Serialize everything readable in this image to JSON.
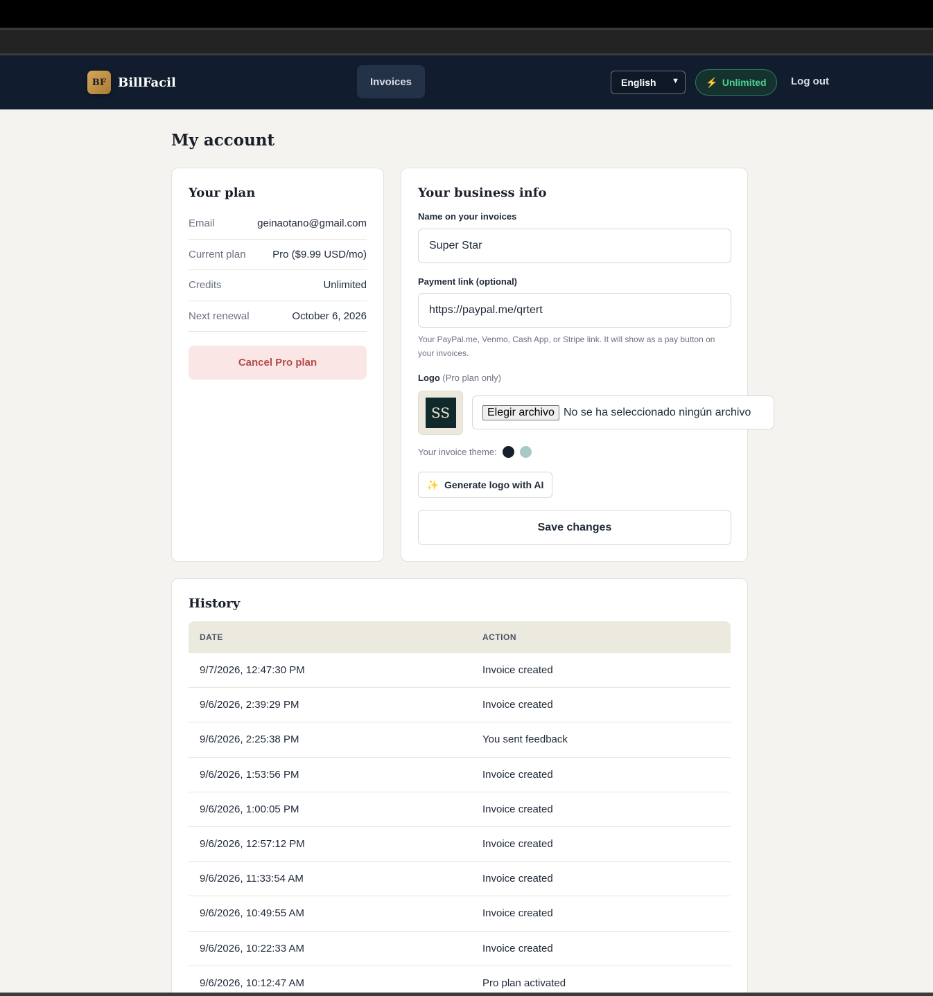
{
  "navbar": {
    "brand_badge": "BF",
    "brand_name": "BillFacil",
    "invoices_label": "Invoices",
    "language": "English",
    "plan_badge": "Unlimited",
    "logout_label": "Log out"
  },
  "page": {
    "title": "My account"
  },
  "plan": {
    "title": "Your plan",
    "rows": [
      {
        "label": "Email",
        "value": "geinaotano@gmail.com"
      },
      {
        "label": "Current plan",
        "value": "Pro ($9.99 USD/mo)"
      },
      {
        "label": "Credits",
        "value": "Unlimited"
      },
      {
        "label": "Next renewal",
        "value": "October 6, 2026"
      }
    ],
    "cancel_label": "Cancel Pro plan"
  },
  "business": {
    "title": "Your business info",
    "name_label": "Name on your invoices",
    "name_value": "Super Star",
    "payment_label": "Payment link (optional)",
    "payment_value": "https://paypal.me/qrtert",
    "payment_help": "Your PayPal.me, Venmo, Cash App, or Stripe link. It will show as a pay button on your invoices.",
    "logo_label": "Logo",
    "logo_note": "(Pro plan only)",
    "logo_initials": "SS",
    "file_button": "Elegir archivo",
    "file_status": "No se ha seleccionado ningún archivo",
    "theme_label": "Your invoice theme:",
    "theme_colors": [
      "#14202c",
      "#a9c9c9"
    ],
    "ai_label": "Generate logo with AI",
    "save_label": "Save changes"
  },
  "history": {
    "title": "History",
    "col_date": "DATE",
    "col_action": "ACTION",
    "rows": [
      {
        "date": "9/7/2026, 12:47:30 PM",
        "action": "Invoice created"
      },
      {
        "date": "9/6/2026, 2:39:29 PM",
        "action": "Invoice created"
      },
      {
        "date": "9/6/2026, 2:25:38 PM",
        "action": "You sent feedback"
      },
      {
        "date": "9/6/2026, 1:53:56 PM",
        "action": "Invoice created"
      },
      {
        "date": "9/6/2026, 1:00:05 PM",
        "action": "Invoice created"
      },
      {
        "date": "9/6/2026, 12:57:12 PM",
        "action": "Invoice created"
      },
      {
        "date": "9/6/2026, 11:33:54 AM",
        "action": "Invoice created"
      },
      {
        "date": "9/6/2026, 10:49:55 AM",
        "action": "Invoice created"
      },
      {
        "date": "9/6/2026, 10:22:33 AM",
        "action": "Invoice created"
      },
      {
        "date": "9/6/2026, 10:12:47 AM",
        "action": "Pro plan activated"
      }
    ]
  }
}
